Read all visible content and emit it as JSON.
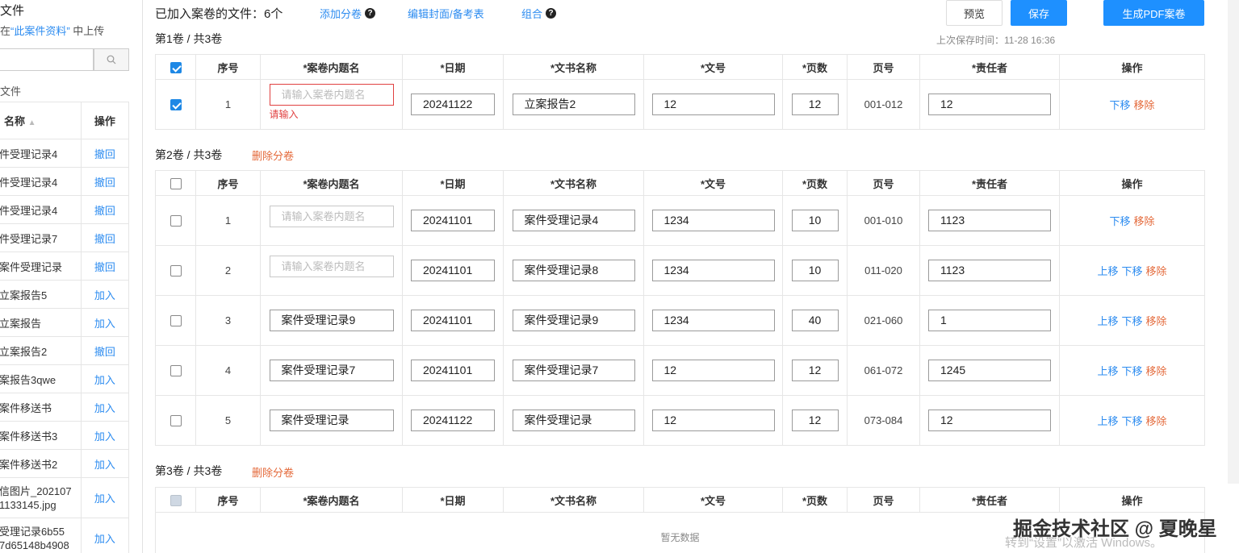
{
  "left": {
    "title": "文件",
    "hint_prefix": "在",
    "hint_quote": "“此案件资料”",
    "hint_suffix": " 中上传",
    "subtitle": "文件",
    "col_name": "名称",
    "col_op": "操作",
    "rows": [
      {
        "name": "件受理记录4",
        "op": "撤回"
      },
      {
        "name": "件受理记录4",
        "op": "撤回"
      },
      {
        "name": "件受理记录4",
        "op": "撤回"
      },
      {
        "name": "件受理记录7",
        "op": "撤回"
      },
      {
        "name": "案件受理记录",
        "op": "撤回"
      },
      {
        "name": "立案报告5",
        "op": "加入"
      },
      {
        "name": "立案报告",
        "op": "加入"
      },
      {
        "name": "立案报告2",
        "op": "撤回"
      },
      {
        "name": "案报告3qwe",
        "op": "加入"
      },
      {
        "name": "案件移送书",
        "op": "加入"
      },
      {
        "name": "案件移送书3",
        "op": "加入"
      },
      {
        "name": "案件移送书2",
        "op": "加入"
      },
      {
        "name": "信图片_202107 1133145.jpg",
        "op": "加入"
      },
      {
        "name": "受理记录6b55 7d65148b4908",
        "op": "加入"
      }
    ]
  },
  "header": {
    "added_files": "已加入案卷的文件：6个",
    "add_volume": "添加分卷",
    "edit_cover": "编辑封面/备考表",
    "combine": "组合",
    "preview": "预览",
    "save": "保存",
    "generate_pdf": "生成PDF案卷",
    "save_time": "上次保存时间：11-28 16:36"
  },
  "columns": [
    "序号",
    "*案卷内题名",
    "*日期",
    "*文书名称",
    "*文号",
    "*页数",
    "页号",
    "*责任者",
    "操作"
  ],
  "placeholder": "请输入案卷内题名",
  "error_msg": "请输入",
  "actions": {
    "up": "上移",
    "down": "下移",
    "remove": "移除"
  },
  "delete_volume": "删除分卷",
  "empty_text": "暂无数据",
  "volumes": [
    {
      "title": "第1卷 / 共3卷",
      "rows": [
        {
          "seq": "1",
          "inner_title": "",
          "date": "20241122",
          "doc_name": "立案报告2",
          "doc_no": "12",
          "pages": "12",
          "page_range": "001-012",
          "owner": "12",
          "checked": true
        }
      ]
    },
    {
      "title": "第2卷 / 共3卷",
      "rows": [
        {
          "seq": "1",
          "inner_title": "",
          "date": "20241101",
          "doc_name": "案件受理记录4",
          "doc_no": "1234",
          "pages": "10",
          "page_range": "001-010",
          "owner": "1123"
        },
        {
          "seq": "2",
          "inner_title": "",
          "date": "20241101",
          "doc_name": "案件受理记录8",
          "doc_no": "1234",
          "pages": "10",
          "page_range": "011-020",
          "owner": "1123"
        },
        {
          "seq": "3",
          "inner_title": "案件受理记录9",
          "date": "20241101",
          "doc_name": "案件受理记录9",
          "doc_no": "1234",
          "pages": "40",
          "page_range": "021-060",
          "owner": "1"
        },
        {
          "seq": "4",
          "inner_title": "案件受理记录7",
          "date": "20241101",
          "doc_name": "案件受理记录7",
          "doc_no": "12",
          "pages": "12",
          "page_range": "061-072",
          "owner": "1245"
        },
        {
          "seq": "5",
          "inner_title": "案件受理记录",
          "date": "20241122",
          "doc_name": "案件受理记录",
          "doc_no": "12",
          "pages": "12",
          "page_range": "073-084",
          "owner": "12"
        }
      ]
    },
    {
      "title": "第3卷 / 共3卷",
      "rows": []
    }
  ],
  "watermark": {
    "line1": "掘金技术社区 @ 夏晚星",
    "line2": "转到“设置”以激活 Windows。"
  }
}
